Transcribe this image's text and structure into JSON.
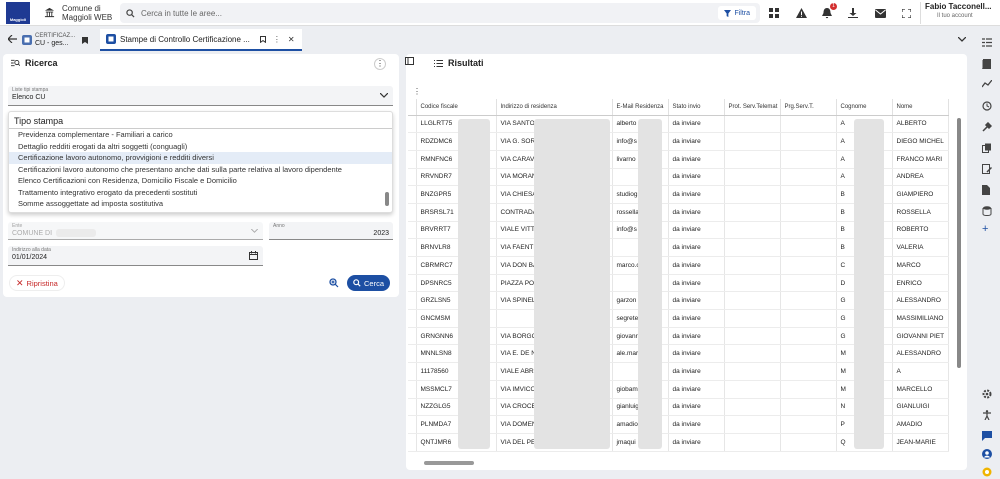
{
  "app": {
    "name_line1": "Comune di",
    "name_line2": "Maggioli WEB"
  },
  "search": {
    "placeholder": "Cerca in tutte le aree...",
    "filter_label": "Filtra"
  },
  "notifications": {
    "count": "1"
  },
  "user": {
    "name": "Fabio Tacconell...",
    "subtitle": "Il tuo account"
  },
  "tabs": [
    {
      "line1": "CERTIFICAZ...",
      "line2": "CU - ges..."
    },
    {
      "label": "Stampe di Controllo Certificazione ..."
    }
  ],
  "ricerca": {
    "title": "Ricerca",
    "lista_label": "Liste tipi stampa",
    "lista_value": "Elenco CU",
    "dropdown_header": "Tipo stampa",
    "options": [
      "Previdenza complementare - Familiari a carico",
      "Dettaglio redditi erogati da altri soggetti (conguagli)",
      "Certificazione lavoro autonomo, provvigioni e redditi diversi",
      "Certificazioni lavoro autonomo che presentano anche dati sulla parte relativa al lavoro dipendente",
      "Elenco Certificazioni con Residenza, Domicilio Fiscale e Domicilio",
      "Trattamento integrativo erogato da precedenti sostituti",
      "Somme assoggettate ad imposta sostitutiva"
    ],
    "selected_option": 2,
    "ente_label": "Ente",
    "ente_value": "COMUNE DI",
    "anno_label": "Anno",
    "anno_value": "2023",
    "data_label": "Indirizzo alla data",
    "data_value": "01/01/2024",
    "reset_label": "Ripristina",
    "search_label": "Cerca"
  },
  "risultati": {
    "title": "Risultati",
    "columns": [
      "Codice fiscale",
      "Indirizzo di residenza",
      "E-Mail Residenza",
      "Stato invio",
      "Prot. Serv.Telemat",
      "Prg.Serv.T.",
      "Cognome",
      "Nome"
    ],
    "rows": [
      [
        "LLGLRT75",
        "VIA SANTO",
        "alberto",
        "da inviare",
        "",
        "",
        "A",
        "ALBERTO"
      ],
      [
        "RDZDMC6",
        "VIA G. SORA",
        "info@s",
        "da inviare",
        "",
        "",
        "A",
        "DIEGO MICHEL"
      ],
      [
        "RMNFNC6",
        "VIA CARAVA",
        "livarno",
        "da inviare",
        "",
        "",
        "A",
        "FRANCO MARI"
      ],
      [
        "RRVNDR7",
        "VIA MORAN",
        "",
        "da inviare",
        "",
        "",
        "A",
        "ANDREA"
      ],
      [
        "BNZGPR5",
        "VIA CHIESA",
        "studiog",
        "da inviare",
        "",
        "",
        "B",
        "GIAMPIERO"
      ],
      [
        "BRSRSL71",
        "CONTRADA",
        "rossella",
        "da inviare",
        "",
        "",
        "B",
        "ROSSELLA"
      ],
      [
        "BRVRRT7",
        "VIALE VITTO",
        "info@s",
        "da inviare",
        "",
        "",
        "B",
        "ROBERTO"
      ],
      [
        "BRNVLR8",
        "VIA FAENTIN",
        "",
        "da inviare",
        "",
        "",
        "B",
        "VALERIA"
      ],
      [
        "CBRMRC7",
        "VIA DON BA",
        "marco.c",
        "da inviare",
        "",
        "",
        "C",
        "MARCO"
      ],
      [
        "DPSNRC5",
        "PIAZZA PON",
        "",
        "da inviare",
        "",
        "",
        "D",
        "ENRICO"
      ],
      [
        "GRZLSN5",
        "VIA SPINELI",
        "garzon",
        "da inviare",
        "",
        "",
        "G",
        "ALESSANDRO"
      ],
      [
        "GNCMSM",
        "",
        "segrete",
        "da inviare",
        "",
        "",
        "G",
        "MASSIMILIANO"
      ],
      [
        "GRNGNN6",
        "VIA BORGO",
        "giovanr",
        "da inviare",
        "",
        "",
        "G",
        "GIOVANNI PIET"
      ],
      [
        "MNNLSN8",
        "VIA E. DE NI",
        "ale.mar",
        "da inviare",
        "",
        "",
        "M",
        "ALESSANDRO"
      ],
      [
        "11178560",
        "VIALE ABRU",
        "",
        "da inviare",
        "",
        "",
        "M",
        "A"
      ],
      [
        "MSSMCL7",
        "VIA IMVICO",
        "giobam",
        "da inviare",
        "",
        "",
        "M",
        "MARCELLO"
      ],
      [
        "NZZGLG5",
        "VIA CROCEF",
        "gianluig",
        "da inviare",
        "",
        "",
        "N",
        "GIANLUIGI"
      ],
      [
        "PLNMDA7",
        "VIA DOMEN",
        "amadio",
        "da inviare",
        "",
        "",
        "P",
        "AMADIO"
      ],
      [
        "QNTJMR6",
        "VIA DEL PEF",
        "jmaqui",
        "da inviare",
        "",
        "",
        "Q",
        "JEAN-MARIE"
      ]
    ]
  }
}
